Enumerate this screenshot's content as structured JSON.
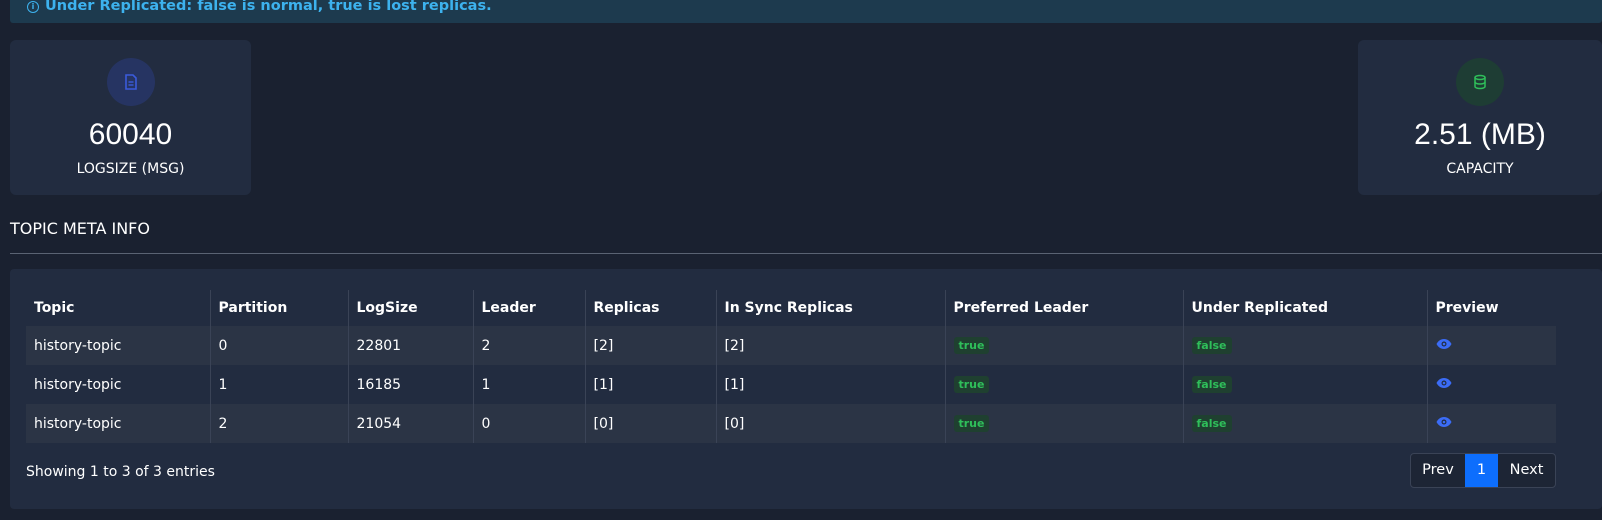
{
  "alert": {
    "icon": "info-icon",
    "text": "Under Replicated: false is normal, true is lost replicas."
  },
  "cards": {
    "logsize": {
      "icon": "file-icon",
      "value": "60040",
      "label": "LOGSIZE (MSG)",
      "color": "#3b5bdb"
    },
    "capacity": {
      "icon": "database-icon",
      "value": "2.51 (MB)",
      "label": "CAPACITY",
      "color": "#2fbf5a"
    }
  },
  "section": {
    "title": "TOPIC META INFO"
  },
  "table": {
    "headers": [
      "Topic",
      "Partition",
      "LogSize",
      "Leader",
      "Replicas",
      "In Sync Replicas",
      "Preferred Leader",
      "Under Replicated",
      "Preview"
    ],
    "rows": [
      {
        "topic": "history-topic",
        "partition": "0",
        "logsize": "22801",
        "leader": "2",
        "replicas": "[2]",
        "isr": "[2]",
        "preferred": "true",
        "under": "false",
        "preview_icon": "eye-icon"
      },
      {
        "topic": "history-topic",
        "partition": "1",
        "logsize": "16185",
        "leader": "1",
        "replicas": "[1]",
        "isr": "[1]",
        "preferred": "true",
        "under": "false",
        "preview_icon": "eye-icon"
      },
      {
        "topic": "history-topic",
        "partition": "2",
        "logsize": "21054",
        "leader": "0",
        "replicas": "[0]",
        "isr": "[0]",
        "preferred": "true",
        "under": "false",
        "preview_icon": "eye-icon"
      }
    ]
  },
  "footer": {
    "info": "Showing 1 to 3 of 3 entries"
  },
  "pagination": {
    "prev": "Prev",
    "current": "1",
    "next": "Next"
  },
  "colors": {
    "background": "#1a2130",
    "panel": "#222c40",
    "accent": "#0d6efd",
    "alert_text": "#3db2ee",
    "badge_green": "#2fbf5a"
  }
}
